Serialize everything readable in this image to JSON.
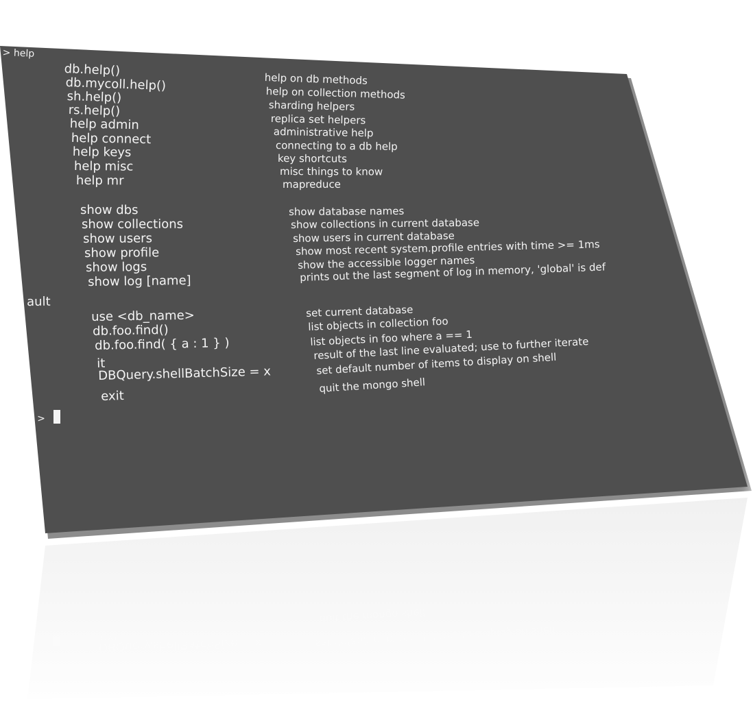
{
  "terminal": {
    "prompt_line": "> help",
    "help_groups": [
      {
        "rows": [
          {
            "cmd": "db.help()",
            "desc": "help on db methods"
          },
          {
            "cmd": "db.mycoll.help()",
            "desc": "help on collection methods"
          },
          {
            "cmd": "sh.help()",
            "desc": "sharding helpers"
          },
          {
            "cmd": "rs.help()",
            "desc": "replica set helpers"
          },
          {
            "cmd": "help admin",
            "desc": "administrative help"
          },
          {
            "cmd": "help connect",
            "desc": "connecting to a db help"
          },
          {
            "cmd": "help keys",
            "desc": "key shortcuts"
          },
          {
            "cmd": "help misc",
            "desc": "misc things to know"
          },
          {
            "cmd": "help mr",
            "desc": "mapreduce"
          }
        ]
      },
      {
        "rows": [
          {
            "cmd": "show dbs",
            "desc": "show database names"
          },
          {
            "cmd": "show collections",
            "desc": "show collections in current database"
          },
          {
            "cmd": "show users",
            "desc": "show users in current database"
          },
          {
            "cmd": "show profile",
            "desc": "show most recent system.profile entries with time >= 1ms"
          },
          {
            "cmd": "show logs",
            "desc": "show the accessible logger names"
          },
          {
            "cmd": "show log [name]",
            "desc": "prints out the last segment of log in memory, 'global' is def"
          }
        ]
      }
    ],
    "wrap_continuation": "ault",
    "help_group3": [
      {
        "cmd": "use <db_name>",
        "desc": "set current database"
      },
      {
        "cmd": "db.foo.find()",
        "desc": "list objects in collection foo"
      },
      {
        "cmd": "db.foo.find( { a : 1 } )",
        "desc": "list objects in foo where a == 1"
      },
      {
        "cmd": "it",
        "desc": "result of the last line evaluated; use to further iterate"
      },
      {
        "cmd": "DBQuery.shellBatchSize = x",
        "desc": "set default number of items to display on shell"
      },
      {
        "cmd": "exit",
        "desc": "quit the mongo shell"
      }
    ],
    "input_prompt": ">"
  },
  "reflection": {
    "lines": [
      "quit the mongo shell",
      "set default number of items to display on shell",
      "DBQuery.shellBatchSize = x",
      "exit"
    ]
  }
}
